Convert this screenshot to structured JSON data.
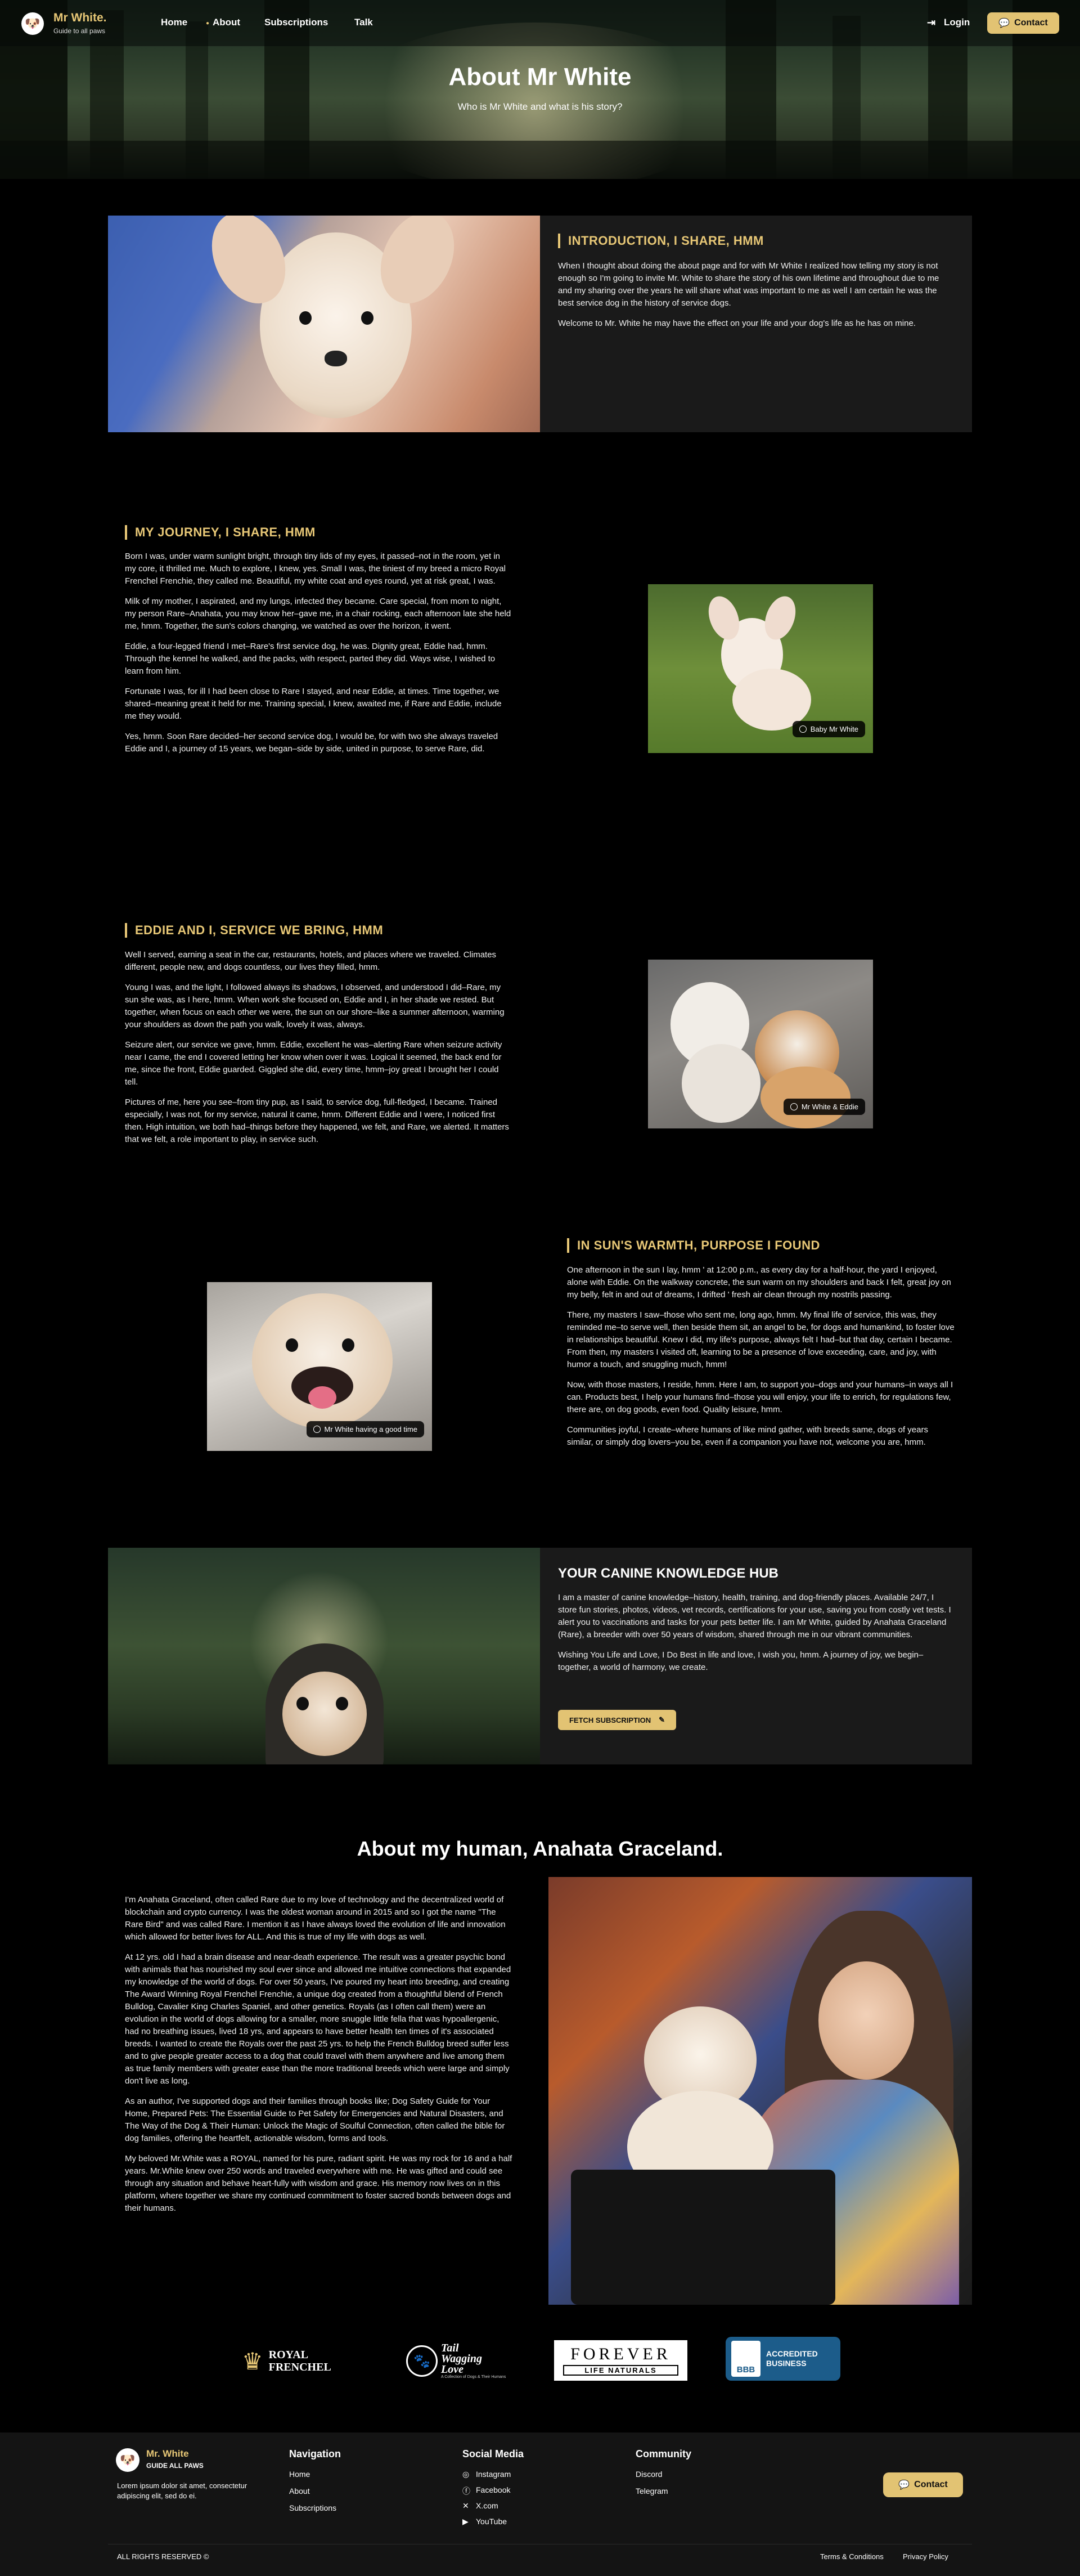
{
  "header": {
    "brand": "Mr White.",
    "brand_sub": "Guide to all paws",
    "nav": [
      "Home",
      "About",
      "Subscriptions",
      "Talk"
    ],
    "login": "Login",
    "contact": "Contact"
  },
  "hero": {
    "title": "About Mr White",
    "subtitle": "Who is Mr White and what is his story?"
  },
  "intro": {
    "heading": "INTRODUCTION, I SHARE, HMM",
    "paragraphs": [
      "When I thought about doing the about page and for with Mr White I realized how telling my story is not enough so I'm going to invite Mr. White to share the story of his own lifetime and throughout due to me and my sharing over the years he will share what was important to me as well I am certain he was the best service dog in the history of service dogs.",
      "Welcome to Mr. White he may have the effect on your life and your dog's life as he has on mine."
    ]
  },
  "journey": {
    "heading": "MY JOURNEY, I SHARE, HMM",
    "paragraphs": [
      "Born I was, under warm sunlight bright, through tiny lids of my eyes, it passed–not in the room, yet in my core, it thrilled me. Much to explore, I knew, yes. Small I was, the tiniest of my breed a micro Royal Frenchel Frenchie, they called me. Beautiful, my white coat and eyes round, yet at risk great, I was.",
      "Milk of my mother, I aspirated, and my lungs, infected they became. Care special, from mom to night, my person Rare–Anahata, you may know her–gave me, in a chair rocking, each afternoon late she held me, hmm. Together, the sun's colors changing, we watched as over the horizon, it went.",
      "Eddie, a four-legged friend I met–Rare's first service dog, he was. Dignity great, Eddie had, hmm. Through the kennel he walked, and the packs, with respect, parted they did. Ways wise, I wished to learn from him.",
      "Fortunate I was, for ill I had been close to Rare I stayed, and near Eddie, at times. Time together, we shared–meaning great it held for me. Training special, I knew, awaited me, if Rare and Eddie, include me they would.",
      "Yes, hmm. Soon Rare decided–her second service dog, I would be, for with two she always traveled Eddie and I, a journey of 15 years, we began–side by side, united in purpose, to serve Rare, did."
    ],
    "badge": "Baby Mr White"
  },
  "eddie": {
    "heading": "EDDIE AND I, SERVICE WE BRING, HMM",
    "paragraphs": [
      "Well I served, earning a seat in the car, restaurants, hotels, and places where we traveled. Climates different, people new, and dogs countless, our lives they filled, hmm.",
      "Young I was, and the light, I followed always its shadows, I observed, and understood I did–Rare, my sun she was, as I here, hmm. When work she focused on, Eddie and I, in her shade we rested. But together, when focus on each other we were, the sun on our shore–like a summer afternoon, warming your shoulders as down the path you walk, lovely it was, always.",
      "Seizure alert, our service we gave, hmm. Eddie, excellent he was–alerting Rare when seizure activity near I came, the end I covered letting her know when over it was. Logical it seemed, the back end for me, since the front, Eddie guarded. Giggled she did, every time, hmm–joy great I brought her I could tell.",
      "Pictures of me, here you see–from tiny pup, as I said, to service dog, full-fledged, I became. Trained especially, I was not, for my service, natural it came, hmm. Different Eddie and I were, I noticed first then. High intuition, we both had–things before they happened, we felt, and Rare, we alerted. It matters that we felt, a role important to play, in service such."
    ],
    "badge": "Mr White & Eddie"
  },
  "sun": {
    "heading": "IN SUN'S WARMTH, PURPOSE I FOUND",
    "paragraphs": [
      "One afternoon in the sun I lay, hmm ' at 12:00 p.m., as every day for a half-hour, the yard I enjoyed, alone with Eddie. On the walkway concrete, the sun warm on my shoulders and back I felt, great joy on my belly, felt in and out of dreams, I drifted ' fresh air clean through my nostrils passing.",
      "There, my masters I saw–those who sent me, long ago, hmm. My final life of service, this was, they reminded me–to serve well, then beside them sit, an angel to be, for dogs and humankind, to foster love in relationships beautiful. Knew I did, my life's purpose, always felt I had–but that day, certain I became. From then, my masters I visited oft, learning to be a presence of love exceeding, care, and joy, with humor a touch, and snuggling much, hmm!",
      "Now, with those masters, I reside, hmm. Here I am, to support you–dogs and your humans–in ways all I can. Products best, I help your humans find–those you will enjoy, your life to enrich, for regulations few, there are, on dog goods, even food. Quality leisure, hmm.",
      "Communities joyful, I create–where humans of like mind gather, with breeds same, dogs of years similar, or simply dog lovers–you be, even if a companion you have not, welcome you are, hmm."
    ],
    "badge": "Mr White having a good time"
  },
  "hub": {
    "heading": "YOUR CANINE KNOWLEDGE HUB",
    "paragraphs": [
      "I am a master of canine knowledge–history, health, training, and dog-friendly places. Available 24/7, I store fun stories, photos, videos, vet records, certifications for your use, saving you from costly vet tests. I alert you to vaccinations and tasks for your pets better life. I am Mr White, guided by Anahata Graceland (Rare), a breeder with over 50 years of wisdom, shared through me in our vibrant communities.",
      "Wishing You Life and Love, I Do Best in life and love, I wish you, hmm. A journey of joy, we begin–together, a world of harmony, we create."
    ],
    "button": "FETCH SUBSCRIPTION"
  },
  "human": {
    "heading": "About my human, Anahata Graceland.",
    "paragraphs": [
      "I'm Anahata Graceland, often called Rare due to my love of technology and the decentralized world of blockchain and crypto currency. I was the oldest woman around in 2015 and so I got the name \"The Rare Bird\" and was called Rare. I mention it as I have always loved the evolution of life and innovation which allowed for better lives for ALL. And this is true of my life with dogs as well.",
      "At 12 yrs. old I had a brain disease and near-death experience. The result was a greater psychic bond with animals that has nourished my soul ever since and allowed me intuitive connections that expanded my knowledge of the world of dogs. For over 50 years, I've poured my heart into breeding, and creating The Award Winning Royal Frenchel Frenchie, a unique dog created from a thoughtful blend of French Bulldog, Cavalier King Charles Spaniel, and other genetics. Royals (as I often call them) were an evolution in the world of dogs allowing for a smaller, more snuggle little fella that was hypoallergenic, had no breathing issues, lived 18 yrs, and appears to have better health ten times of it's associated breeds. I wanted to create the Royals over the past 25 yrs. to help the French Bulldog breed suffer less and to give people greater access to a dog that could travel with them anywhere and live among them as true family members with greater ease than the more traditional breeds which were large and simply don't live as long.",
      "As an author, I've supported dogs and their families through books like; Dog Safety Guide for Your Home, Prepared Pets: The Essential Guide to Pet Safety for Emergencies and Natural Disasters, and The Way of the Dog & Their Human: Unlock the Magic of Soulful Connection, often called the bible for dog families, offering the heartfelt, actionable wisdom, forms and tools.",
      "My beloved Mr.White was a ROYAL, named for his pure, radiant spirit. He was my rock for 16 and a half years. Mr.White knew over 250 words and traveled everywhere with me. He was gifted and could see through any situation and behave heart-fully with wisdom and grace. His memory now lives on in this platform, where together we share my continued commitment to foster sacred bonds between dogs and their humans."
    ]
  },
  "partners": {
    "royal": [
      "ROYAL",
      "FRENCHEL"
    ],
    "tail": [
      "Tail",
      "Wagging",
      "Love"
    ],
    "tail_sub": "A Collection of Dogs & Their Humans",
    "forever": [
      "FOREVER",
      "LIFE NATURALS"
    ],
    "bbb": [
      "ACCREDITED",
      "BUSINESS"
    ],
    "bbb_logo": "BBB"
  },
  "footer": {
    "brand": "Mr. White",
    "brand_sub": "GUIDE ALL PAWS",
    "blurb": "Lorem ipsum dolor sit amet, consectetur adipiscing elit, sed do ei.",
    "nav_title": "Navigation",
    "nav": [
      "Home",
      "About",
      "Subscriptions"
    ],
    "social_title": "Social Media",
    "social": [
      "Instagram",
      "Facebook",
      "X.com",
      "YouTube"
    ],
    "community_title": "Community",
    "community": [
      "Discord",
      "Telegram"
    ],
    "contact": "Contact",
    "copyright": "ALL RIGHTS RESERVED ©",
    "terms": "Terms & Conditions",
    "privacy": "Privacy Policy"
  },
  "colors": {
    "accent": "#e7c776",
    "panel": "#1a1a1a",
    "footer": "#141414",
    "bbb": "#1c5c8a"
  }
}
